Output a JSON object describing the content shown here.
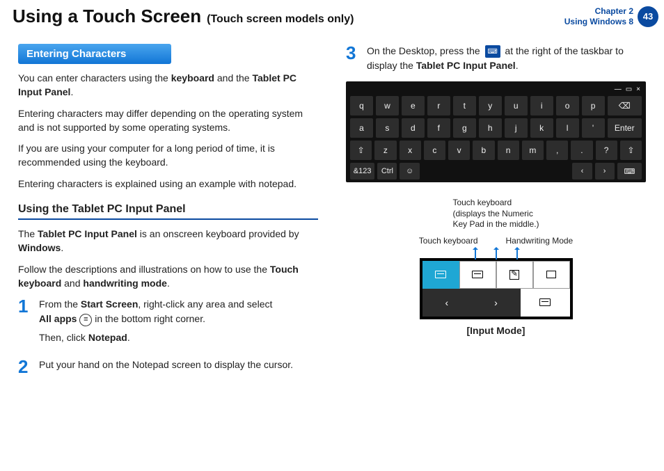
{
  "header": {
    "title": "Using a Touch Screen",
    "subtitle": "(Touch screen models only)",
    "chapter_line1": "Chapter 2",
    "chapter_line2": "Using Windows 8",
    "page": "43"
  },
  "left": {
    "section_heading": "Entering Characters",
    "p1_a": "You can enter characters using the ",
    "p1_b": "keyboard",
    "p1_c": " and the ",
    "p1_d": "Tablet PC Input Panel",
    "p1_e": ".",
    "p2": "Entering characters may differ depending on the operating system and is not supported by some operating systems.",
    "p3": "If you are using your computer for a long period of time, it is recommended using the keyboard.",
    "p4": "Entering characters is explained using an example with notepad.",
    "subhead": "Using the Tablet PC Input Panel",
    "p5_a": "The ",
    "p5_b": "Tablet PC Input Panel",
    "p5_c": " is an onscreen keyboard provided by ",
    "p5_d": "Windows",
    "p5_e": ".",
    "p6_a": "Follow the descriptions and illustrations on how to use the ",
    "p6_b": "Touch keyboard",
    "p6_c": " and ",
    "p6_d": "handwriting mode",
    "p6_e": ".",
    "step1_num": "1",
    "step1_a": "From the ",
    "step1_b": "Start Screen",
    "step1_c": ", right-click any area and select ",
    "step1_d": "All apps",
    "step1_e": " in the bottom right corner.",
    "step1_f": "Then, click ",
    "step1_g": "Notepad",
    "step1_h": ".",
    "step2_num": "2",
    "step2": "Put your hand on the Notepad screen to display the cursor."
  },
  "right": {
    "step3_num": "3",
    "step3_a": "On the Desktop, press the ",
    "step3_b": " at the right of the taskbar to display the ",
    "step3_c": "Tablet PC Input Panel",
    "step3_d": ".",
    "kbd": {
      "r1": [
        "q",
        "w",
        "e",
        "r",
        "t",
        "y",
        "u",
        "i",
        "o",
        "p",
        "⌫"
      ],
      "r2": [
        "a",
        "s",
        "d",
        "f",
        "g",
        "h",
        "j",
        "k",
        "l",
        "'",
        "Enter"
      ],
      "r3": [
        "⇧",
        "z",
        "x",
        "c",
        "v",
        "b",
        "n",
        "m",
        ",",
        ".",
        "?",
        "⇧"
      ],
      "r4": [
        "&123",
        "Ctrl",
        "☺",
        "",
        "‹",
        "›",
        "⌨"
      ]
    },
    "label_top": "Touch keyboard\n(displays the Numeric\nKey Pad in the middle.)",
    "label_left": "Touch keyboard",
    "label_right": "Handwriting Mode",
    "caption": "[Input Mode]"
  }
}
